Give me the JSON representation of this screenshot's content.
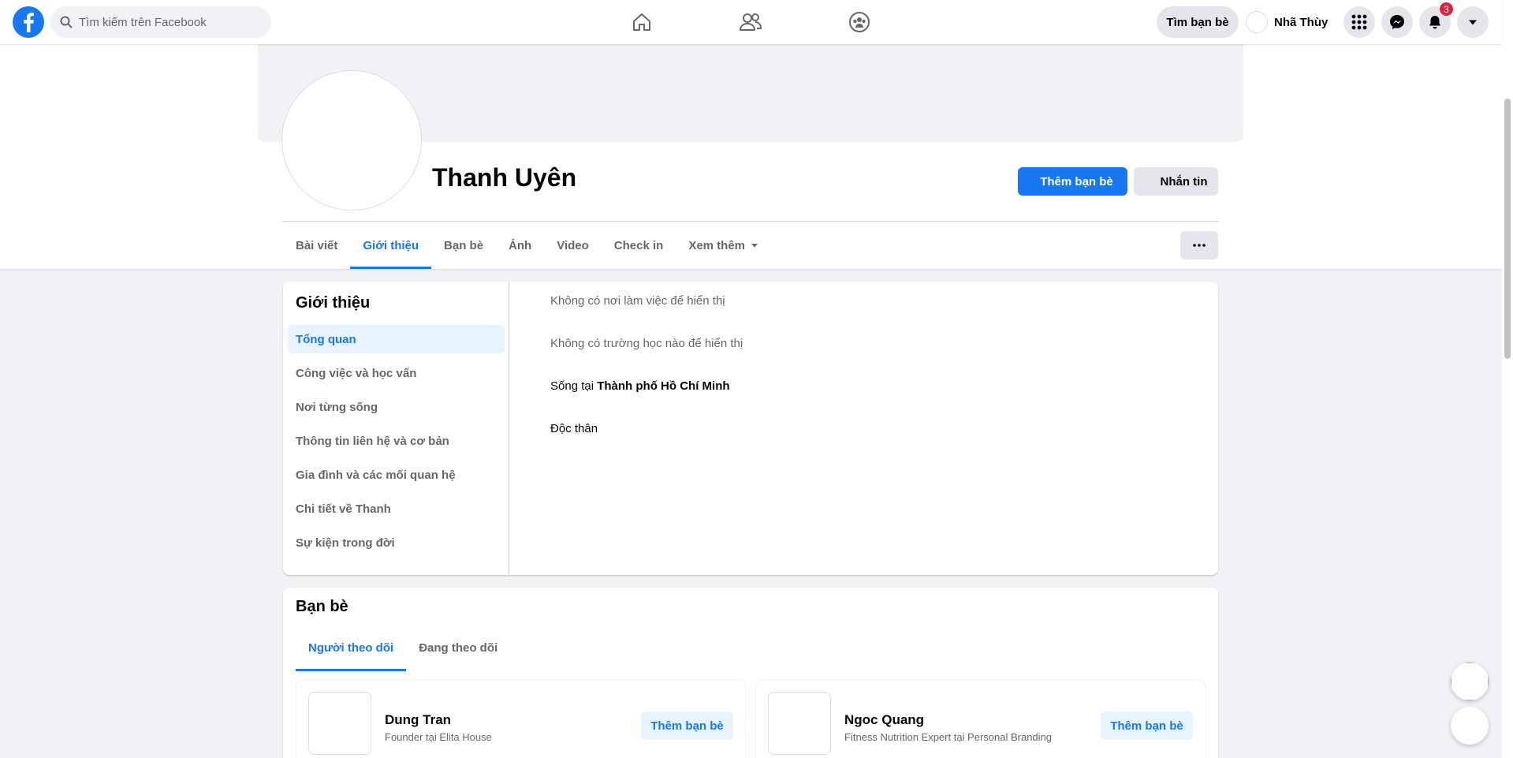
{
  "topbar": {
    "search_placeholder": "Tìm kiếm trên Facebook",
    "find_friends_label": "Tìm bạn bè",
    "user_name": "Nhã Thùy",
    "notification_count": "3",
    "icons": [
      "facebook-logo-icon",
      "search-icon",
      "home-icon",
      "friends-icon",
      "groups-icon",
      "menu-grid-icon",
      "messenger-icon",
      "bell-icon",
      "caret-down-icon"
    ]
  },
  "profile": {
    "name": "Thanh Uyên",
    "add_friend_label": "Thêm bạn bè",
    "message_label": "Nhắn tin",
    "tabs": [
      "Bài viết",
      "Giới thiệu",
      "Bạn bè",
      "Ảnh",
      "Video",
      "Check in",
      "Xem thêm"
    ],
    "active_tab": "Giới thiệu"
  },
  "about": {
    "title": "Giới thiệu",
    "nav": [
      "Tổng quan",
      "Công việc và học vấn",
      "Nơi từng sống",
      "Thông tin liên hệ và cơ bản",
      "Gia đình và các mối quan hệ",
      "Chi tiết về Thanh",
      "Sự kiện trong đời"
    ],
    "active_nav": "Tổng quan",
    "no_work": "Không có nơi làm việc để hiển thị",
    "no_school": "Không có trường học nào để hiển thị",
    "lives_prefix": "Sống tại ",
    "lives_city": "Thành phố Hồ Chí Minh",
    "relationship": "Độc thân"
  },
  "friends": {
    "title": "Bạn bè",
    "tabs": [
      "Người theo dõi",
      "Đang theo dõi"
    ],
    "active_tab": "Người theo dõi",
    "items": [
      {
        "name": "Dung Tran",
        "subtitle": "Founder tại Elita House",
        "action": "Thêm bạn bè"
      },
      {
        "name": "Ngoc Quang",
        "subtitle": "Fitness Nutrition Expert tại Personal Branding",
        "action": "Thêm bạn bè"
      }
    ]
  },
  "colors": {
    "brand": "#1877f2",
    "background": "#f0f2f5",
    "badge": "#e41e3f",
    "secondary_text": "#65676b"
  }
}
